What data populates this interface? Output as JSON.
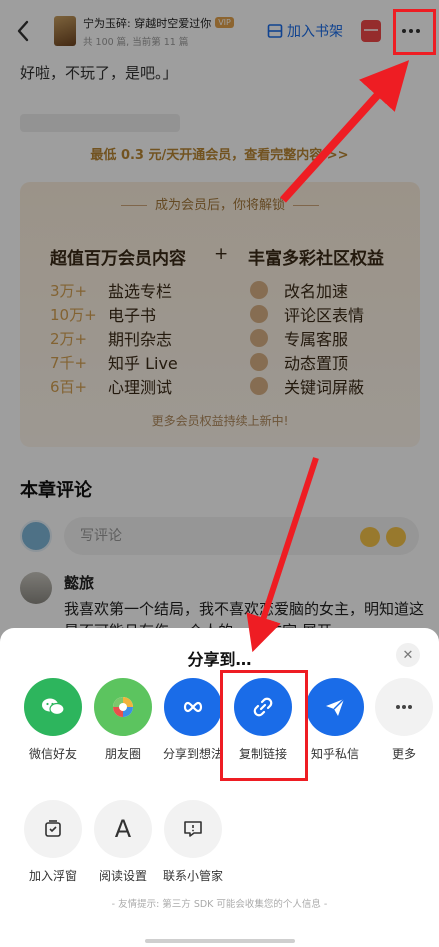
{
  "header": {
    "book_title": "宁为玉碎: 穿越时空爱过你",
    "vip_badge": "VIP",
    "book_sub": "共 100 篇, 当前第 11 篇",
    "shelf_label": "加入书架"
  },
  "content": {
    "prev_text": "好啦，不玩了，是吧。」",
    "promo_link": "最低 0.3 元/天开通会员，查看完整内容 >>",
    "vip_card": {
      "head": "成为会员后，你将解锁",
      "left_title": "超值百万会员内容",
      "plus": "+",
      "right_title": "丰富多彩社区权益",
      "left_items": [
        {
          "qty": "3万+",
          "label": "盐选专栏"
        },
        {
          "qty": "10万+",
          "label": "电子书"
        },
        {
          "qty": "2万+",
          "label": "期刊杂志"
        },
        {
          "qty": "7千+",
          "label": "知乎 Live"
        },
        {
          "qty": "6百+",
          "label": "心理测试"
        }
      ],
      "right_items": [
        {
          "label": "改名加速"
        },
        {
          "label": "评论区表情"
        },
        {
          "label": "专属客服"
        },
        {
          "label": "动态置顶"
        },
        {
          "label": "关键词屏蔽"
        }
      ],
      "footer": "更多会员权益持续上新中!"
    },
    "comments": {
      "title": "本章评论",
      "input_placeholder": "写评论",
      "first": {
        "user": "懿旅",
        "text": "我喜欢第一个结局，我不喜欢恋爱脑的女主，明知道这是不可能且有伤... 众人的... 你在宫 展开"
      }
    }
  },
  "sheet": {
    "title": "分享到…",
    "close": "✕",
    "row1": [
      {
        "label": "微信好友",
        "icon": "wechat-icon",
        "color": "#2db55d"
      },
      {
        "label": "朋友圈",
        "icon": "moments-icon",
        "color": "#5cc45f"
      },
      {
        "label": "分享到想法",
        "icon": "idea-icon",
        "color": "#1a6ce8"
      },
      {
        "label": "复制链接",
        "icon": "link-icon",
        "color": "#1a6ce8"
      },
      {
        "label": "知乎私信",
        "icon": "paper-plane-icon",
        "color": "#1a6ce8"
      },
      {
        "label": "更多",
        "icon": "more-icon",
        "color": "#f2f2f2"
      }
    ],
    "row2": [
      {
        "label": "加入浮窗",
        "icon": "float-window-icon"
      },
      {
        "label": "阅读设置",
        "icon": "font-icon",
        "glyph": "A"
      },
      {
        "label": "联系小管家",
        "icon": "chat-icon"
      }
    ],
    "note": "- 友情提示: 第三方 SDK 可能会收集您的个人信息 -"
  },
  "colors": {
    "accent": "#1a6ce8",
    "annotation_red": "#ee1d23",
    "vip_gold": "#d3a052"
  }
}
